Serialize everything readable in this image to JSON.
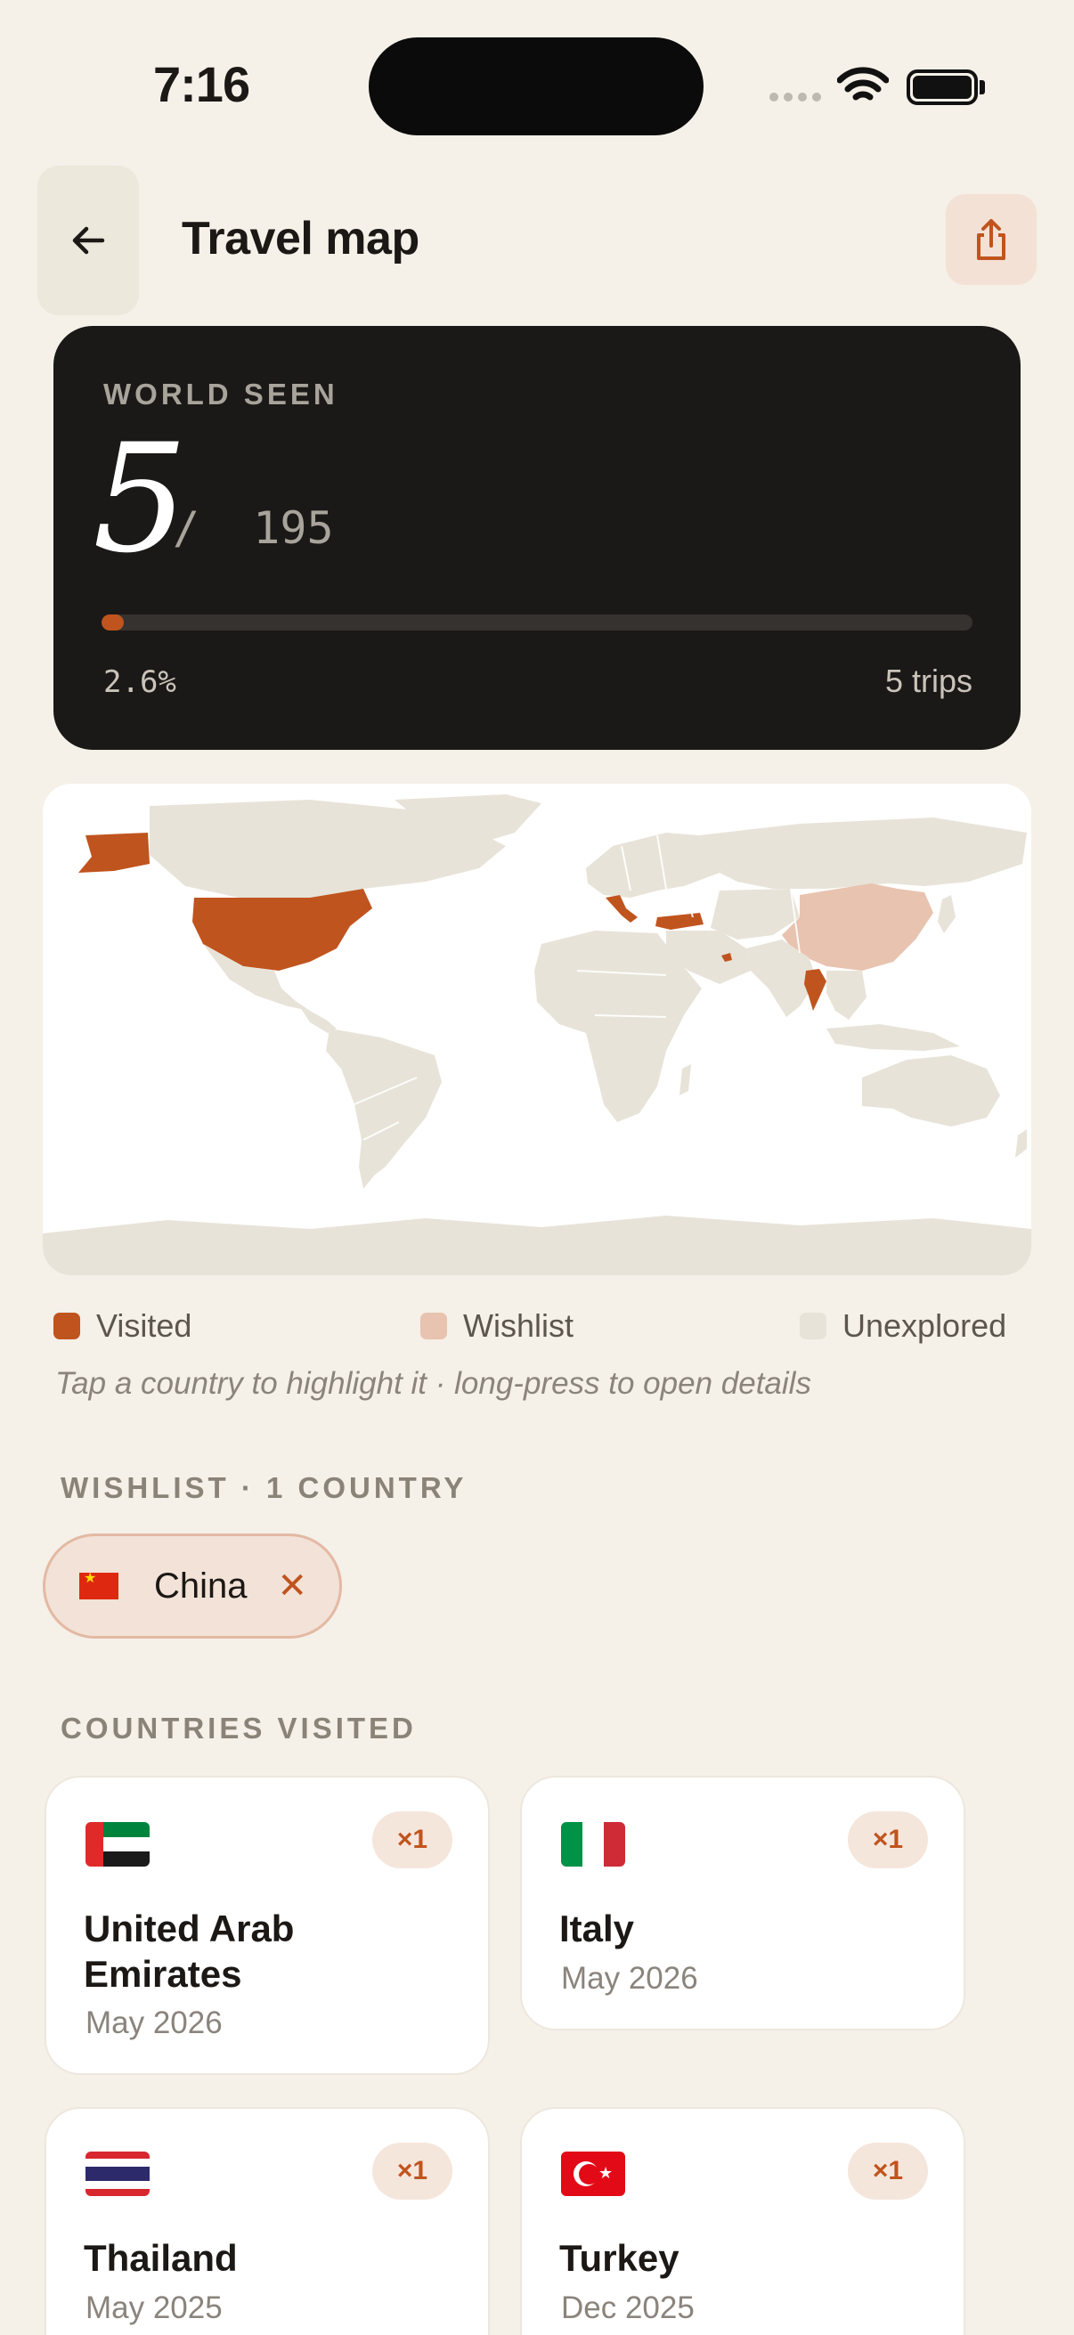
{
  "status_bar": {
    "time": "7:16"
  },
  "header": {
    "title": "Travel map",
    "back_icon": "arrow-left-icon",
    "share_icon": "share-icon"
  },
  "stats": {
    "label": "WORLD SEEN",
    "visited_count": "5",
    "total": "/  195",
    "progress_fraction": 0.026,
    "percent": "2.6%",
    "trips": "5 trips"
  },
  "colors": {
    "accent": "#C0541E",
    "visited": "#C0541E",
    "wishlist": "#E8C3B0",
    "unexplored": "#E8E3D8",
    "background": "#F5F0E8",
    "card_dark": "#1B1917"
  },
  "legend": {
    "visited": "Visited",
    "wishlist": "Wishlist",
    "unexplored": "Unexplored",
    "hint": "Tap a country to highlight it · long-press to open details"
  },
  "wishlist": {
    "label": "WISHLIST · 1 COUNTRY",
    "items": [
      {
        "name": "China",
        "remove": "✕"
      }
    ]
  },
  "visited_section": {
    "label": "COUNTRIES VISITED",
    "cards": [
      {
        "name": "United Arab Emirates",
        "line1": "United Arab",
        "line2": "Emirates",
        "date": "May 2026",
        "count": "×1"
      },
      {
        "name": "Italy",
        "date": "May 2026",
        "count": "×1"
      },
      {
        "name": "Thailand",
        "date": "May 2025",
        "count": "×1"
      },
      {
        "name": "Turkey",
        "date": "Dec 2025",
        "count": "×1"
      }
    ]
  }
}
